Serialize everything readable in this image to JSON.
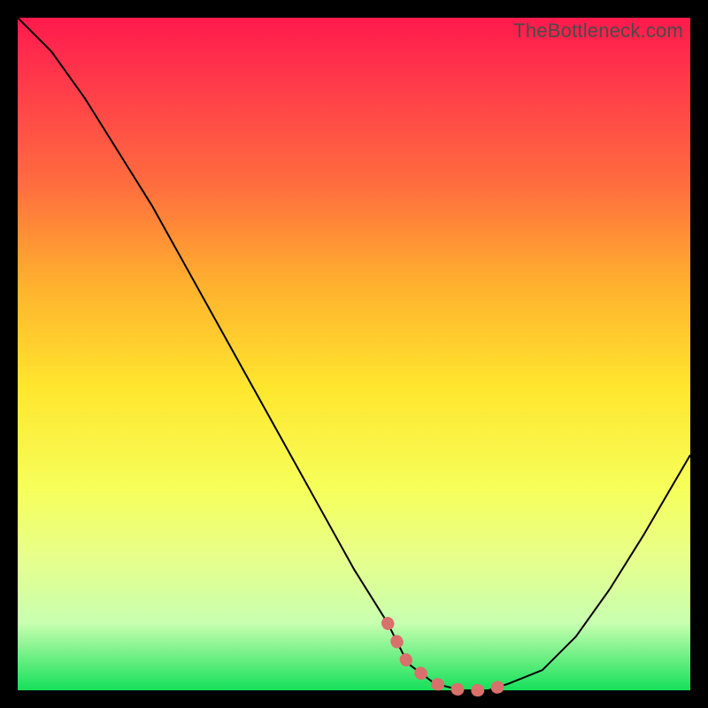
{
  "watermark": {
    "text": "TheBottleneck.com"
  },
  "chart_data": {
    "type": "line",
    "title": "",
    "xlabel": "",
    "ylabel": "",
    "xlim": [
      0,
      100
    ],
    "ylim": [
      0,
      100
    ],
    "grid": false,
    "series": [
      {
        "name": "bottleneck-curve",
        "x": [
          0,
          5,
          10,
          15,
          20,
          25,
          30,
          35,
          40,
          45,
          50,
          55,
          58,
          62,
          66,
          70,
          73,
          78,
          83,
          88,
          93,
          100
        ],
        "values": [
          100,
          95,
          88,
          80,
          72,
          63,
          54,
          45,
          36,
          27,
          18,
          10,
          4,
          1,
          0,
          0,
          1,
          3,
          8,
          15,
          23,
          35
        ]
      }
    ],
    "highlight": {
      "name": "optimal-zone",
      "x": [
        55,
        58,
        62,
        66,
        70,
        73
      ],
      "values": [
        10,
        4,
        1,
        0,
        0,
        1
      ]
    },
    "colors": {
      "curve": "#000000",
      "highlight": "#d9706b",
      "background_top": "#ff1a4d",
      "background_bottom": "#15e05a"
    }
  }
}
